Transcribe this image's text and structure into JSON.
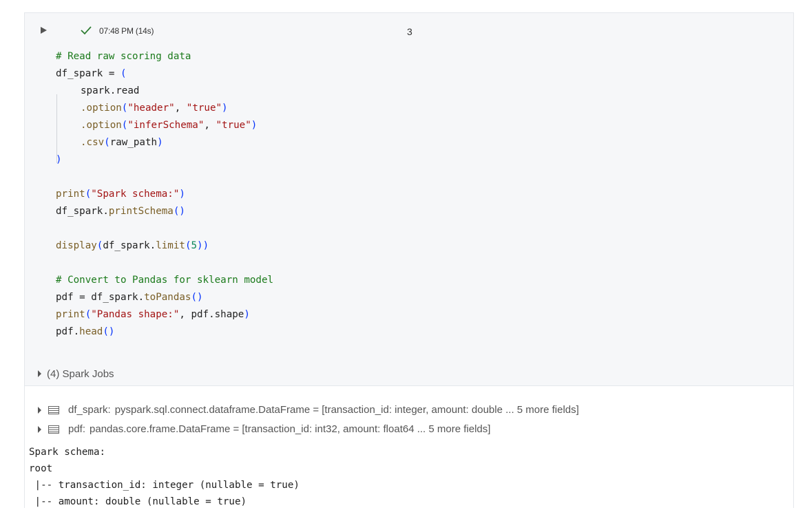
{
  "cell": {
    "status_time": "07:48 PM (14s)",
    "cell_number": "3"
  },
  "icons": {
    "run": "play-icon",
    "status": "check-icon",
    "variable": "table-icon"
  },
  "colors": {
    "check": "#2e7d32",
    "comment": "#1b7a1b",
    "string": "#a31515",
    "function": "#795e26",
    "paren": "#0431fa",
    "number": "#098658"
  },
  "code": {
    "l1": "# Read raw scoring data",
    "l2a": "df_spark = ",
    "l2b": "(",
    "l3": "spark.read",
    "l4a": ".option",
    "l4b": "(",
    "l4c": "\"header\"",
    "l4d": ", ",
    "l4e": "\"true\"",
    "l4f": ")",
    "l5a": ".option",
    "l5b": "(",
    "l5c": "\"inferSchema\"",
    "l5d": ", ",
    "l5e": "\"true\"",
    "l5f": ")",
    "l6a": ".csv",
    "l6b": "(",
    "l6c": "raw_path",
    "l6d": ")",
    "l7": ")",
    "l9a": "print",
    "l9b": "(",
    "l9c": "\"Spark schema:\"",
    "l9d": ")",
    "l10a": "df_spark.",
    "l10b": "printSchema",
    "l10c": "()",
    "l12a": "display",
    "l12b": "(",
    "l12c": "df_spark.",
    "l12d": "limit",
    "l12e": "(",
    "l12f": "5",
    "l12g": ")",
    "l12h": ")",
    "l14": "# Convert to Pandas for sklearn model",
    "l15a": "pdf = df_spark.",
    "l15b": "toPandas",
    "l15c": "()",
    "l16a": "print",
    "l16b": "(",
    "l16c": "\"Pandas shape:\"",
    "l16d": ", pdf.shape",
    "l16e": ")",
    "l17a": "pdf.",
    "l17b": "head",
    "l17c": "()"
  },
  "spark_jobs": {
    "label": "(4) Spark Jobs"
  },
  "variables": [
    {
      "name": "df_spark:",
      "type": "pyspark.sql.connect.dataframe.DataFrame = [transaction_id: integer, amount: double ... 5 more fields]"
    },
    {
      "name": "pdf:",
      "type": "pandas.core.frame.DataFrame = [transaction_id: int32, amount: float64 ... 5 more fields]"
    }
  ],
  "stdout": [
    "Spark schema:",
    "root",
    " |-- transaction_id: integer (nullable = true)",
    " |-- amount: double (nullable = true)"
  ]
}
